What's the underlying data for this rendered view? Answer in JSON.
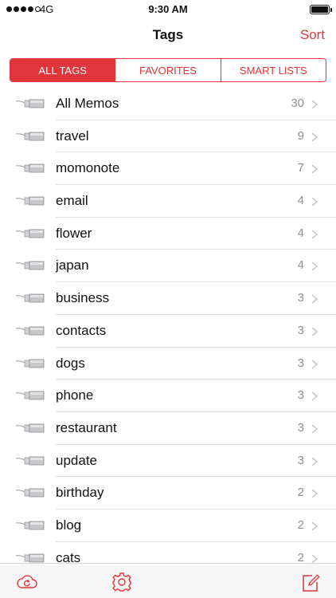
{
  "status": {
    "carrier": "4G",
    "time": "9:30 AM"
  },
  "nav": {
    "title": "Tags",
    "sort_label": "Sort"
  },
  "segments": [
    {
      "label": "ALL TAGS",
      "active": true
    },
    {
      "label": "FAVORITES",
      "active": false
    },
    {
      "label": "SMART LISTS",
      "active": false
    }
  ],
  "tags": [
    {
      "label": "All Memos",
      "count": "30"
    },
    {
      "label": "travel",
      "count": "9"
    },
    {
      "label": "momonote",
      "count": "7"
    },
    {
      "label": "email",
      "count": "4"
    },
    {
      "label": "flower",
      "count": "4"
    },
    {
      "label": "japan",
      "count": "4"
    },
    {
      "label": "business",
      "count": "3"
    },
    {
      "label": "contacts",
      "count": "3"
    },
    {
      "label": "dogs",
      "count": "3"
    },
    {
      "label": "phone",
      "count": "3"
    },
    {
      "label": "restaurant",
      "count": "3"
    },
    {
      "label": "update",
      "count": "3"
    },
    {
      "label": "birthday",
      "count": "2"
    },
    {
      "label": "blog",
      "count": "2"
    },
    {
      "label": "cats",
      "count": "2"
    }
  ],
  "tabbar": {
    "icons": [
      "cloud-sync-icon",
      "gear-icon",
      "compose-icon"
    ]
  },
  "colors": {
    "accent": "#e0353a",
    "count": "#8e8e93",
    "separator": "#e2e2e6"
  }
}
